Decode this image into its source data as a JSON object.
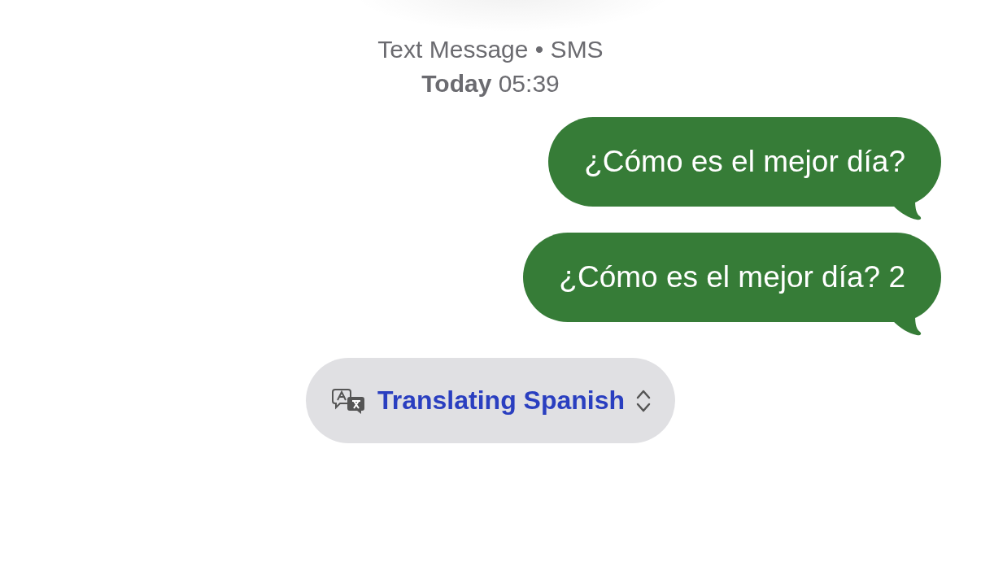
{
  "header": {
    "service": "Text Message • SMS",
    "timestamp": "**Today** 05:39"
  },
  "messages": [
    {
      "text": "¿Cómo es el mejor día?",
      "kind": "sent"
    },
    {
      "text": "¿Cómo es el mejor día? 2",
      "kind": "sent"
    }
  ],
  "translation_button": {
    "label": "Translating Spanish"
  }
}
